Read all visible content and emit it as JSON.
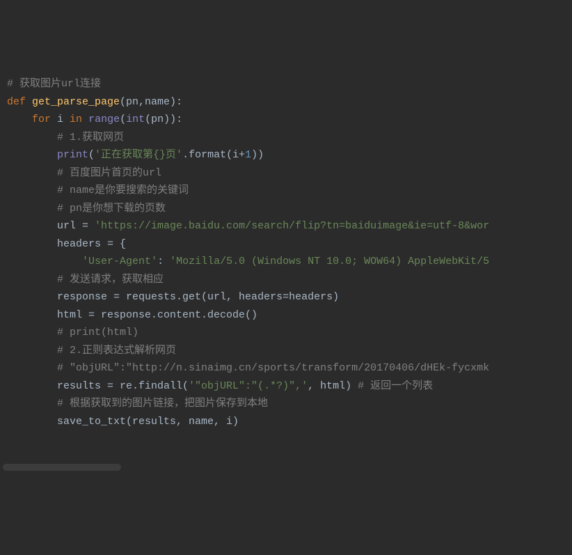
{
  "code": {
    "l1": {
      "c1": "# 获取图片url连接"
    },
    "l2": {
      "kw1": "def ",
      "fn": "get_parse_page",
      "p": "(pn,name):"
    },
    "l3": {
      "blank": ""
    },
    "l4": {
      "ind": "    ",
      "kw1": "for ",
      "v": "i ",
      "kw2": "in ",
      "bi": "range",
      "p1": "(",
      "bi2": "int",
      "p2": "(pn)):"
    },
    "l5": {
      "ind": "        ",
      "c1": "# 1.获取网页"
    },
    "l6": {
      "ind": "        ",
      "bi": "print",
      "p1": "(",
      "s1": "'正在获取第{}页'",
      "p2": ".format(i+",
      "n1": "1",
      "p3": "))"
    },
    "l7": {
      "blank": ""
    },
    "l8": {
      "ind": "        ",
      "c1": "# 百度图片首页的url"
    },
    "l9": {
      "ind": "        ",
      "c1": "# name是你要搜索的关键词"
    },
    "l10": {
      "ind": "        ",
      "c1": "# pn是你想下载的页数"
    },
    "l11": {
      "blank": ""
    },
    "l12": {
      "ind": "        ",
      "v": "url = ",
      "s1": "'https://image.baidu.com/search/flip?tn=baiduimage&ie=utf-8&wor"
    },
    "l13": {
      "blank": ""
    },
    "l14": {
      "ind": "        ",
      "v": "headers = {"
    },
    "l15": {
      "ind": "            ",
      "s1": "'User-Agent'",
      "p": ": ",
      "s2": "'Mozilla/5.0 (Windows NT 10.0; WOW64) AppleWebKit/5"
    },
    "l16": {
      "blank": ""
    },
    "l17": {
      "ind": "        ",
      "c1": "# 发送请求，获取相应"
    },
    "l18": {
      "ind": "        ",
      "v": "response = requests.get(url, headers=headers)"
    },
    "l19": {
      "ind": "        ",
      "v": "html = response.content.decode()"
    },
    "l20": {
      "ind": "        ",
      "c1": "# print(html)"
    },
    "l21": {
      "blank": ""
    },
    "l22": {
      "ind": "        ",
      "c1": "# 2.正则表达式解析网页"
    },
    "l23": {
      "ind": "        ",
      "c1": "# \"objURL\":\"http://n.sinaimg.cn/sports/transform/20170406/dHEk-fycxmk"
    },
    "l24": {
      "ind": "        ",
      "v": "results = re.findall(",
      "s1": "'\"objURL\":\"(.*?)\",'",
      "p": ", html) ",
      "c1": "# 返回一个列表"
    },
    "l25": {
      "blank": ""
    },
    "l26": {
      "ind": "        ",
      "c1": "# 根据获取到的图片链接，把图片保存到本地"
    },
    "l27": {
      "ind": "        ",
      "v": "save_to_txt(results, name, i)"
    }
  }
}
